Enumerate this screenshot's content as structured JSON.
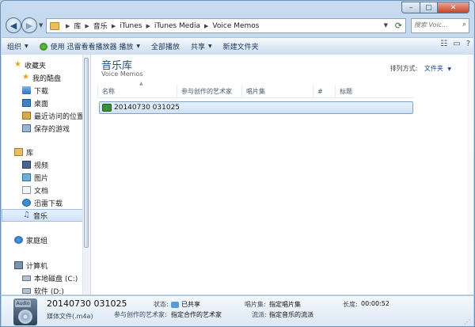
{
  "caption": {
    "minimize": "–",
    "maximize": "▢",
    "close": "✕"
  },
  "address": {
    "crumbs": [
      "库",
      "音乐",
      "iTunes",
      "iTunes Media",
      "Voice Memos"
    ],
    "search_placeholder": "搜索 Voic..."
  },
  "toolbar": {
    "organize": "组织",
    "play_with": "使用 迅雷看看播放器 播放",
    "play_all": "全部播放",
    "share": "共享",
    "new_folder": "新建文件夹"
  },
  "sidebar": {
    "favorites": "收藏夹",
    "fav_items": [
      "我的酷盘",
      "下载",
      "桌面",
      "最近访问的位置",
      "保存的游戏"
    ],
    "libraries": "库",
    "lib_items": [
      "视频",
      "图片",
      "文档",
      "迅雷下载",
      "音乐"
    ],
    "homegroup": "家庭组",
    "computer": "计算机",
    "computer_items": [
      "本地磁盘 (C:)",
      "软件 (D:)"
    ]
  },
  "content": {
    "title": "音乐库",
    "subtitle": "Voice Memos",
    "arrange_label": "排列方式:",
    "arrange_value": "文件夹",
    "columns": [
      "名称",
      "参与创作的艺术家",
      "唱片集",
      "#",
      "标题"
    ],
    "files": [
      {
        "name": "20140730 031025"
      }
    ]
  },
  "details": {
    "file_name": "20140730 031025",
    "file_type": "媒体文件(.m4a)",
    "thumb_badge": "Audio",
    "status_label": "状态:",
    "status_value": "已共享",
    "artist_label": "参与创作的艺术家:",
    "artist_value": "指定合作的艺术家",
    "album_label": "唱片集:",
    "album_value": "指定唱片集",
    "genre_label": "流派:",
    "genre_value": "指定音乐的流派",
    "length_label": "长度:",
    "length_value": "00:00:52"
  }
}
